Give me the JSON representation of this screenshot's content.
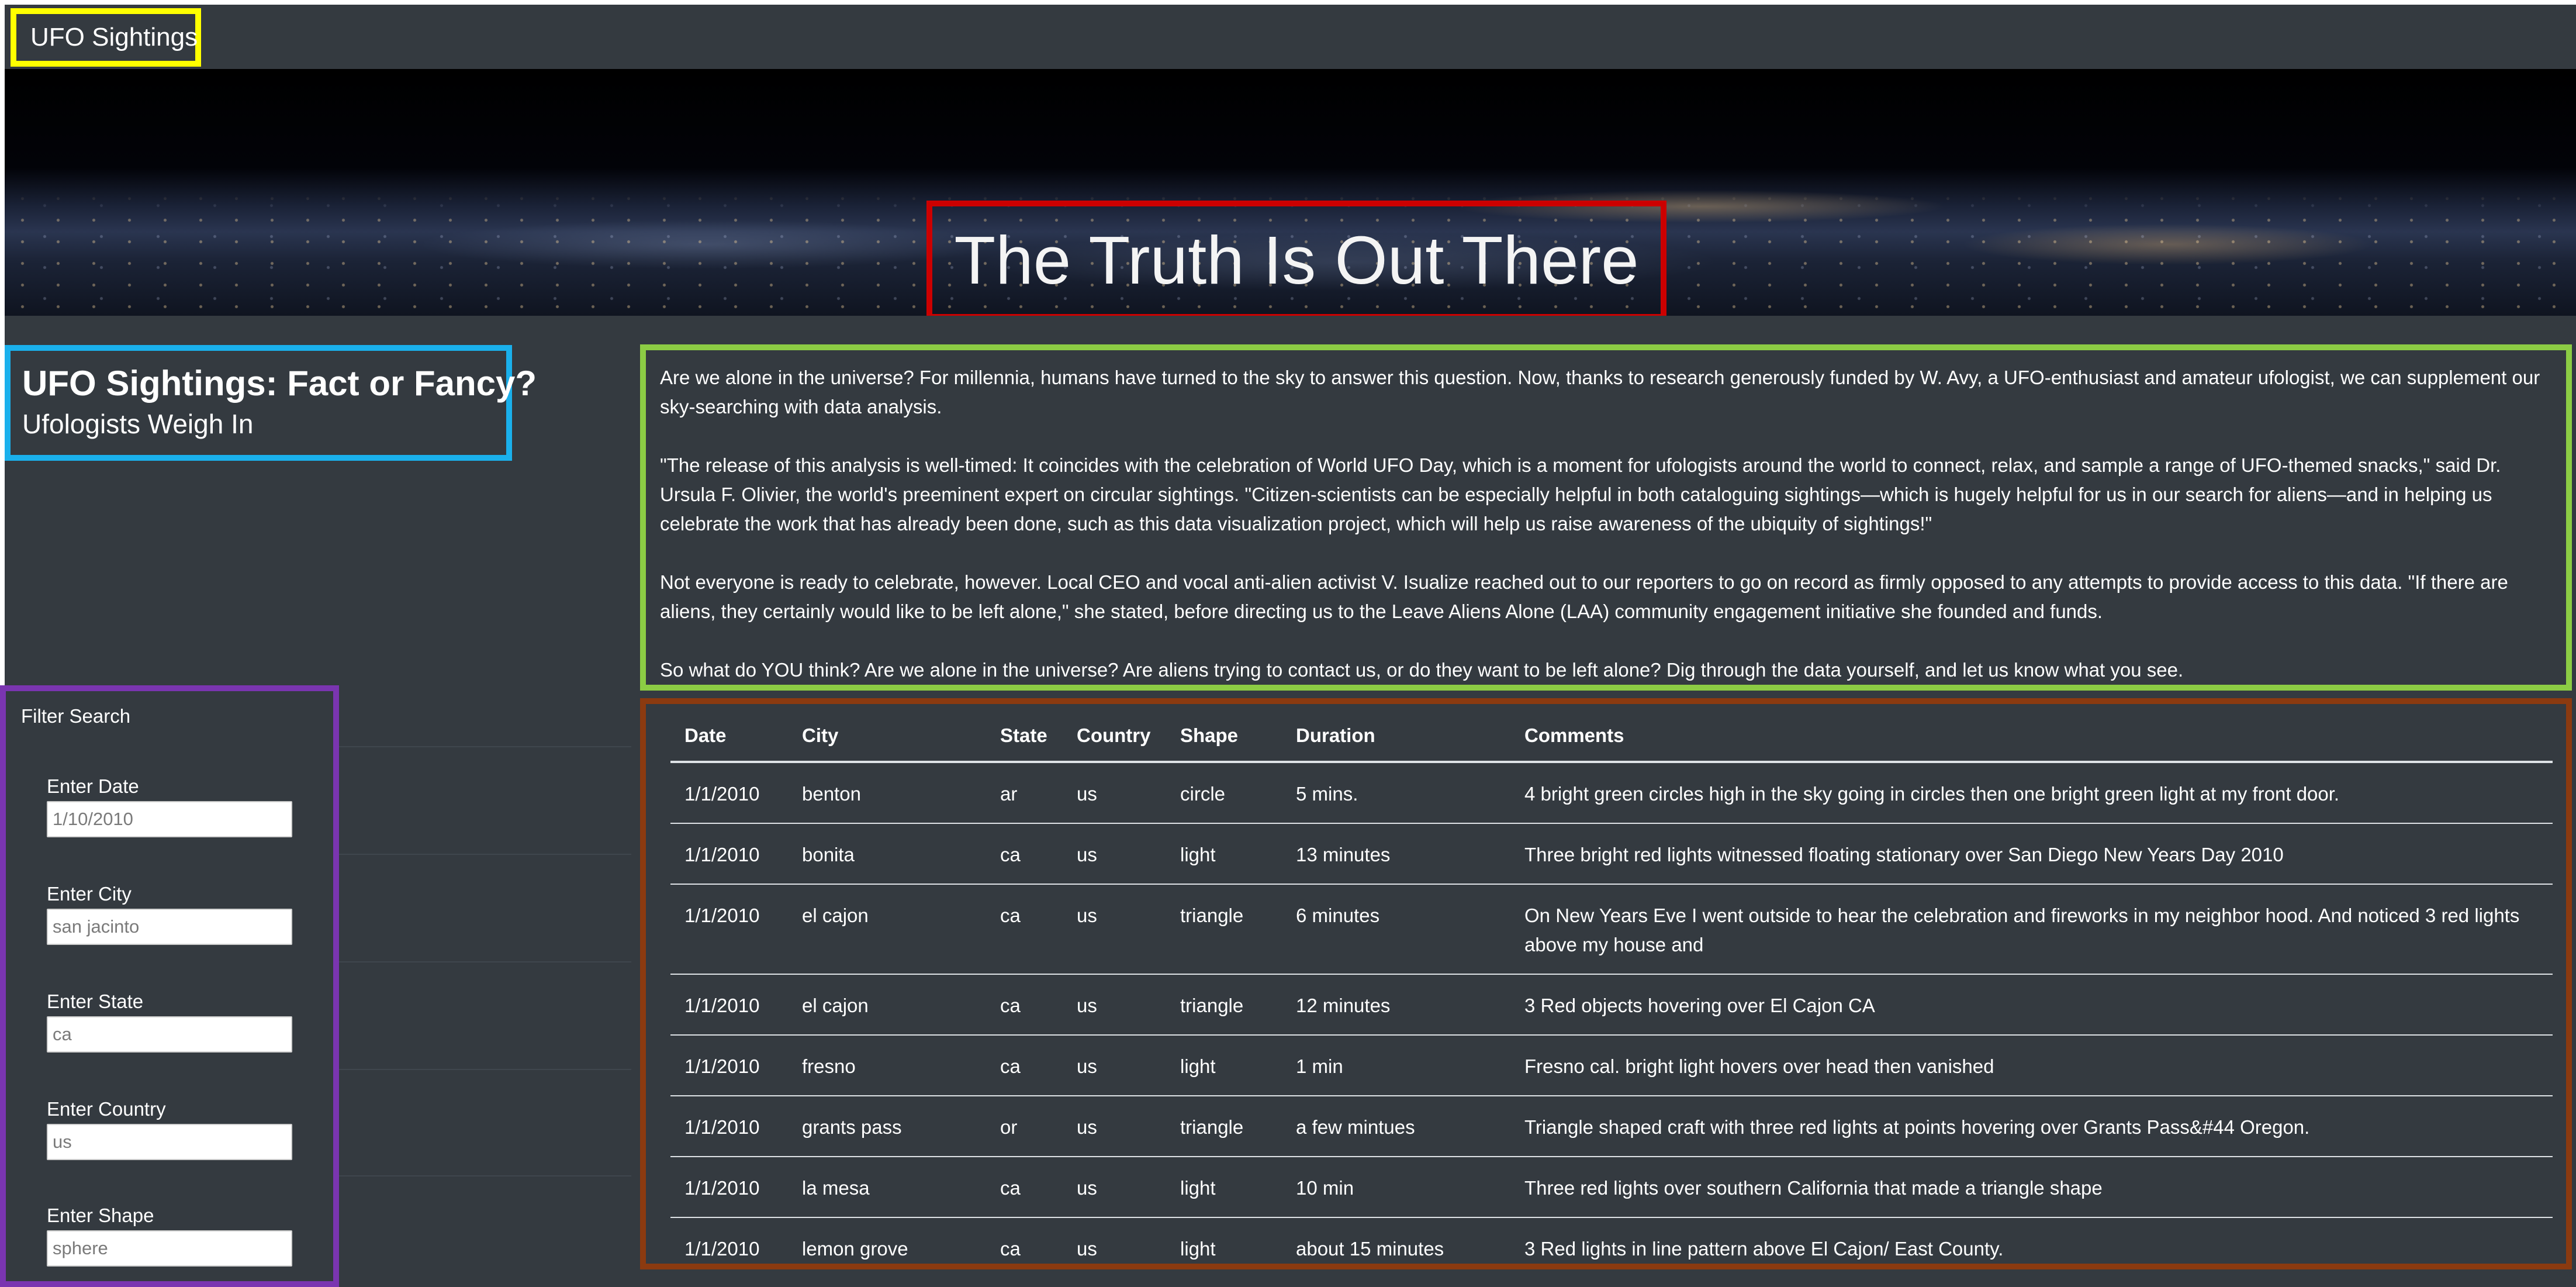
{
  "navbar": {
    "brand": "UFO Sightings"
  },
  "hero": {
    "title": "The Truth Is Out There"
  },
  "heading": {
    "title": "UFO Sightings: Fact or Fancy?",
    "subtitle": "Ufologists Weigh In"
  },
  "article": {
    "paragraphs": [
      "Are we alone in the universe? For millennia, humans have turned to the sky to answer this question. Now, thanks to research generously funded by W. Avy, a UFO-enthusiast and amateur ufologist, we can supplement our sky-searching with data analysis.",
      "\"The release of this analysis is well-timed: It coincides with the celebration of World UFO Day, which is a moment for ufologists around the world to connect, relax, and sample a range of UFO-themed snacks,\" said Dr. Ursula F. Olivier, the world's preeminent expert on circular sightings. \"Citizen-scientists can be especially helpful in both cataloguing sightings—which is hugely helpful for us in our search for aliens—and in helping us celebrate the work that has already been done, such as this data visualization project, which will help us raise awareness of the ubiquity of sightings!\"",
      "Not everyone is ready to celebrate, however. Local CEO and vocal anti-alien activist V. Isualize reached out to our reporters to go on record as firmly opposed to any attempts to provide access to this data. \"If there are aliens, they certainly would like to be left alone,\" she stated, before directing us to the Leave Aliens Alone (LAA) community engagement initiative she founded and funds.",
      "So what do YOU think? Are we alone in the universe? Are aliens trying to contact us, or do they want to be left alone? Dig through the data yourself, and let us know what you see."
    ]
  },
  "filter": {
    "title": "Filter Search",
    "fields": [
      {
        "label": "Enter Date",
        "placeholder": "1/10/2010"
      },
      {
        "label": "Enter City",
        "placeholder": "san jacinto"
      },
      {
        "label": "Enter State",
        "placeholder": "ca"
      },
      {
        "label": "Enter Country",
        "placeholder": "us"
      },
      {
        "label": "Enter Shape",
        "placeholder": "sphere"
      }
    ]
  },
  "table": {
    "headers": [
      "Date",
      "City",
      "State",
      "Country",
      "Shape",
      "Duration",
      "Comments"
    ],
    "rows": [
      [
        "1/1/2010",
        "benton",
        "ar",
        "us",
        "circle",
        "5 mins.",
        "4 bright green circles high in the sky going in circles then one bright green light at my front door."
      ],
      [
        "1/1/2010",
        "bonita",
        "ca",
        "us",
        "light",
        "13 minutes",
        "Three bright red lights witnessed floating stationary over San Diego New Years Day 2010"
      ],
      [
        "1/1/2010",
        "el cajon",
        "ca",
        "us",
        "triangle",
        "6 minutes",
        "On New Years Eve I went outside to hear the celebration and fireworks in my neighbor hood. And noticed 3 red lights above my house and"
      ],
      [
        "1/1/2010",
        "el cajon",
        "ca",
        "us",
        "triangle",
        "12 minutes",
        "3 Red objects hovering over El Cajon CA"
      ],
      [
        "1/1/2010",
        "fresno",
        "ca",
        "us",
        "light",
        "1 min",
        "Fresno cal. bright light hovers over head then vanished"
      ],
      [
        "1/1/2010",
        "grants pass",
        "or",
        "us",
        "triangle",
        "a few mintues",
        "Triangle shaped craft with three red lights at points hovering over Grants Pass&#44 Oregon."
      ],
      [
        "1/1/2010",
        "la mesa",
        "ca",
        "us",
        "light",
        "10 min",
        "Three red lights over southern California that made a triangle shape"
      ],
      [
        "1/1/2010",
        "lemon grove",
        "ca",
        "us",
        "light",
        "about 15 minutes",
        "3 Red lights in line pattern above El Cajon/ East County."
      ]
    ]
  }
}
